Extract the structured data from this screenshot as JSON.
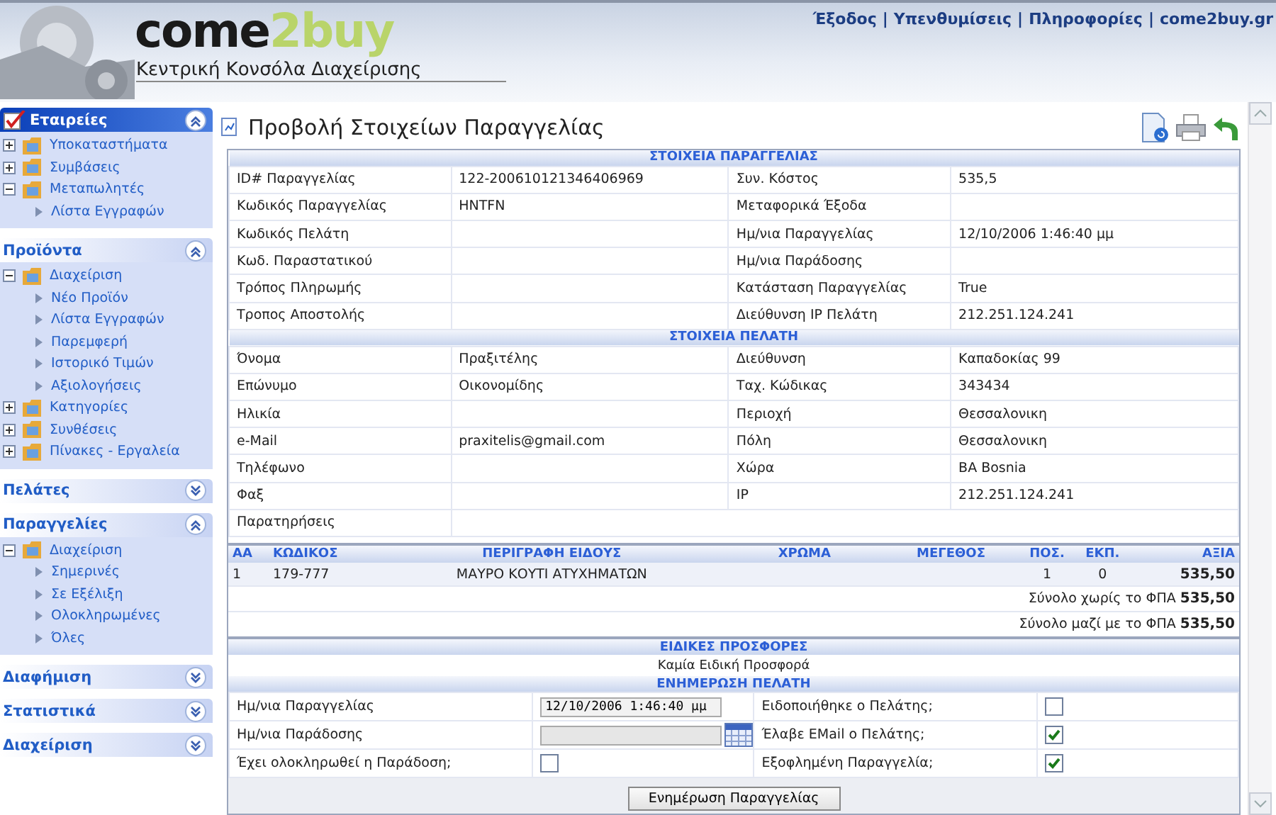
{
  "header": {
    "logo": [
      "come",
      "2buy"
    ],
    "subtitle": "Κεντρική Κονσόλα Διαχείρισης",
    "links": [
      "Έξοδος",
      "Υπενθυμίσεις",
      "Πληροφορίες",
      "come2buy.gr"
    ],
    "separator": "|"
  },
  "sidebar": [
    {
      "title": "Εταιρείες",
      "selected": true,
      "expanded": true,
      "items": [
        {
          "label": "Υποκαταστήματα",
          "expanded": false
        },
        {
          "label": "Συμβάσεις",
          "expanded": false
        },
        {
          "label": "Μεταπωλητές",
          "expanded": true,
          "children": [
            {
              "label": "Λίστα Εγγραφών"
            }
          ]
        }
      ]
    },
    {
      "title": "Προϊόντα",
      "selected": false,
      "expanded": true,
      "items": [
        {
          "label": "Διαχείριση",
          "expanded": true,
          "children": [
            {
              "label": "Νέο Προϊόν"
            },
            {
              "label": "Λίστα Εγγραφών"
            },
            {
              "label": "Παρεμφερή"
            },
            {
              "label": "Ιστορικό Τιμών"
            },
            {
              "label": "Αξιολογήσεις"
            }
          ]
        },
        {
          "label": "Κατηγορίες",
          "expanded": false
        },
        {
          "label": "Συνθέσεις",
          "expanded": false
        },
        {
          "label": "Πίνακες - Εργαλεία",
          "expanded": false
        }
      ]
    },
    {
      "title": "Πελάτες",
      "selected": false,
      "expanded": false
    },
    {
      "title": "Παραγγελίες",
      "selected": false,
      "expanded": true,
      "items": [
        {
          "label": "Διαχείριση",
          "expanded": true,
          "children": [
            {
              "label": "Σημερινές"
            },
            {
              "label": "Σε Εξέλιξη"
            },
            {
              "label": "Ολοκληρωμένες"
            },
            {
              "label": "Όλες"
            }
          ]
        }
      ]
    },
    {
      "title": "Διαφήμιση",
      "selected": false,
      "expanded": false
    },
    {
      "title": "Στατιστικά",
      "selected": false,
      "expanded": false
    },
    {
      "title": "Διαχείριση",
      "selected": false,
      "expanded": false
    }
  ],
  "page_title": "Προβολή Στοιχείων Παραγγελίας",
  "order_section": {
    "title": "ΣΤΟΙΧΕΙΑ ΠΑΡΑΓΓΕΛΙΑΣ",
    "rows": [
      [
        {
          "label": "ID# Παραγγελίας",
          "value": "122-200610121346406969"
        },
        {
          "label": "Συν. Κόστος",
          "value": "535,5"
        }
      ],
      [
        {
          "label": "Κωδικός Παραγγελίας",
          "value": "HNTFN"
        },
        {
          "label": "Μεταφορικά Έξοδα"
        }
      ],
      [
        {
          "label": "Κωδικός Πελάτη"
        },
        {
          "label": "Ημ/νια Παραγγελίας",
          "value": "12/10/2006 1:46:40 μμ"
        }
      ],
      [
        {
          "label": "Κωδ. Παραστατικού"
        },
        {
          "label": "Ημ/νια Παράδοσης"
        }
      ],
      [
        {
          "label": "Τρόπος Πληρωμής"
        },
        {
          "label": "Κατάσταση Παραγγελίας",
          "value": "True"
        }
      ],
      [
        {
          "label": "Τροπος Αποστολής"
        },
        {
          "label": "Διεύθυνση IP Πελάτη",
          "value": "212.251.124.241"
        }
      ]
    ]
  },
  "customer_section": {
    "title": "ΣΤΟΙΧΕΙΑ ΠΕΛΑΤΗ",
    "rows": [
      [
        {
          "label": "Όνομα",
          "value": "Πραξιτέλης"
        },
        {
          "label": "Διεύθυνση",
          "value": "Καπαδοκίας 99"
        }
      ],
      [
        {
          "label": "Επώνυμο",
          "value": "Οικονομίδης"
        },
        {
          "label": "Ταχ. Κώδικας",
          "value": "343434"
        }
      ],
      [
        {
          "label": "Ηλικία"
        },
        {
          "label": "Περιοχή",
          "value": "Θεσσαλονικη"
        }
      ],
      [
        {
          "label": "e-Mail",
          "value": "praxitelis@gmail.com"
        },
        {
          "label": "Πόλη",
          "value": "Θεσσαλονικη"
        }
      ],
      [
        {
          "label": "Τηλέφωνο"
        },
        {
          "label": "Χώρα",
          "value": "BA Bosnia"
        }
      ],
      [
        {
          "label": "Φαξ"
        },
        {
          "label": "IP",
          "value": "212.251.124.241"
        }
      ],
      [
        {
          "label": "Παρατηρήσεις"
        }
      ]
    ]
  },
  "items_table": {
    "columns": [
      {
        "label": "ΑΑ"
      },
      {
        "label": "ΚΩΔΙΚΟΣ"
      },
      {
        "label": "ΠΕΡΙΓΡΑΦΗ ΕΙΔΟΥΣ"
      },
      {
        "label": "ΧΡΩΜΑ"
      },
      {
        "label": "ΜΕΓΕΘΟΣ"
      },
      {
        "label": "ΠΟΣ."
      },
      {
        "label": "ΕΚΠ."
      },
      {
        "label": "ΑΞΙΑ"
      }
    ],
    "rows": [
      {
        "cells": [
          {
            "text": "1"
          },
          {
            "text": "179-777"
          },
          {
            "text": "ΜΑΥΡΟ ΚΟΥΤΙ ΑΤΥΧΗΜΑΤΩΝ"
          },
          {},
          {},
          {
            "text": "1"
          },
          {
            "text": "0"
          },
          {
            "text": "535,50"
          }
        ]
      }
    ],
    "totals": [
      {
        "label": "Σύνολο χωρίς το ΦΠΑ",
        "amount": "535,50"
      },
      {
        "label": "Σύνολο μαζί με το ΦΠΑ",
        "amount": "535,50"
      }
    ]
  },
  "offers_section": {
    "title": "ΕΙΔΙΚΕΣ ΠΡΟΣΦΟΡΕΣ",
    "text": "Καμία Ειδική Προσφορά"
  },
  "update_section": {
    "title": "ΕΝΗΜΕΡΩΣΗ ΠΕΛΑΤΗ",
    "rows": [
      [
        {
          "label": "Ημ/νια Παραγγελίας",
          "kind": "text",
          "value": "12/10/2006 1:46:40 μμ"
        },
        {
          "label": "Ειδοποιήθηκε ο Πελάτης;",
          "kind": "checkbox",
          "checked": false
        }
      ],
      [
        {
          "label": "Ημ/νια Παράδοσης",
          "kind": "date"
        },
        {
          "label": "Έλαβε EMail ο Πελάτης;",
          "kind": "checkbox",
          "checked": true
        }
      ],
      [
        {
          "label": "Έχει ολοκληρωθεί η Παράδοση;",
          "kind": "checkbox",
          "checked": false
        },
        {
          "label": "Εξοφλημένη Παραγγελία;",
          "kind": "checkbox",
          "checked": true
        }
      ]
    ],
    "button": "Ενημέρωση Παραγγελίας"
  }
}
